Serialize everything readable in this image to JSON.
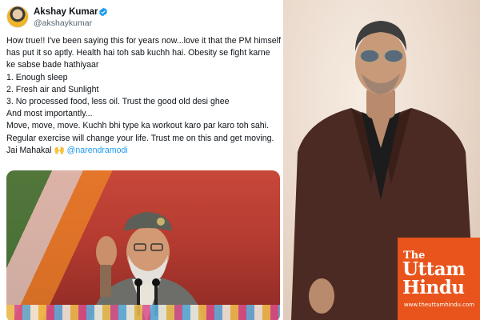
{
  "tweet": {
    "author": {
      "name": "Akshay Kumar",
      "handle": "@akshaykumar",
      "verified_icon": "verified-badge-icon"
    },
    "body_lines": [
      "How true!! I've been saying this for years now...love it that the PM himself",
      "has put it so aptly. Health hai toh sab kuchh hai. Obesity se fight karne",
      "ke sabse bade hathiyaar",
      "1. Enough sleep",
      "2. Fresh air and Sunlight",
      "3. No processed food, less oil. Trust the good old desi ghee",
      "And most importantly...",
      "Move, move, move. Kuchh bhi type ka workout karo par karo toh sahi.",
      "Regular exercise will change your life. Trust me on this and get moving."
    ],
    "closing": {
      "text": "Jai Mahakal",
      "emoji": "🙌",
      "mention": "@narendramodi"
    },
    "media_icon": "embedded-photo"
  },
  "logo": {
    "the": "The",
    "uttam": "Uttam",
    "hindu": "Hindu",
    "url": "www.theuttamhindu.com"
  },
  "colors": {
    "logo_bg": "#e8541c",
    "mention": "#1d9bf0",
    "verified": "#1d9bf0"
  }
}
